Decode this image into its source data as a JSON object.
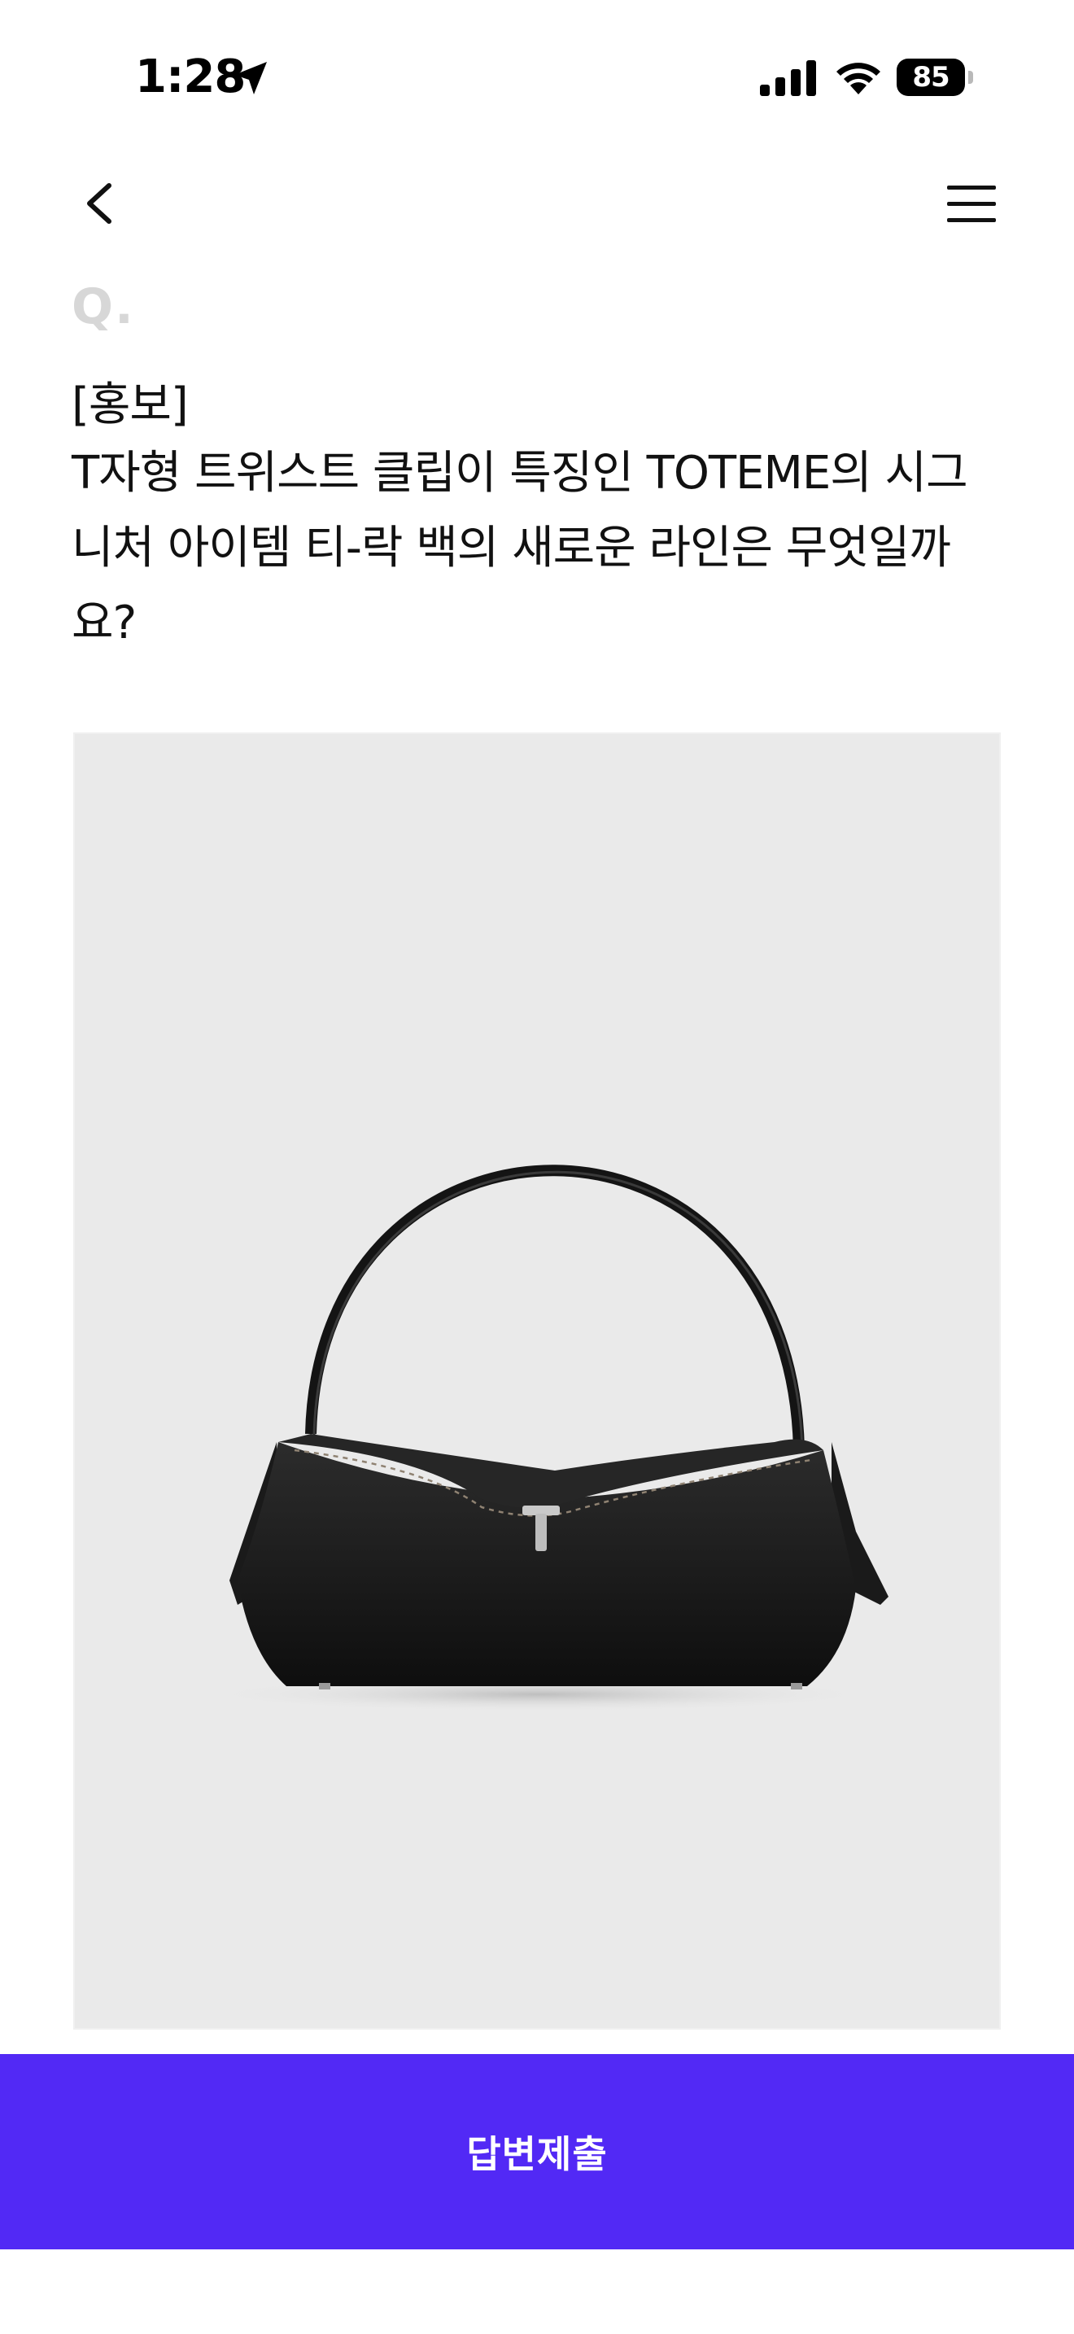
{
  "status_bar": {
    "time": "1:28",
    "battery": "85",
    "icons": [
      "location-arrow-icon",
      "cellular-signal-icon",
      "wifi-icon",
      "battery-icon"
    ]
  },
  "nav": {
    "back_icon": "chevron-left-icon",
    "menu_icon": "hamburger-menu-icon"
  },
  "question": {
    "label": "Q.",
    "tag": "[홍보]",
    "text": "T자형 트위스트 클립이 특징인 TOTEME의 시그니처 아이템 티-락 백의 새로운 라인은 무엇일까요?"
  },
  "product_image": {
    "background": "#eaeaea"
  },
  "submit": {
    "label": "답변제출",
    "color": "#5229f5"
  }
}
